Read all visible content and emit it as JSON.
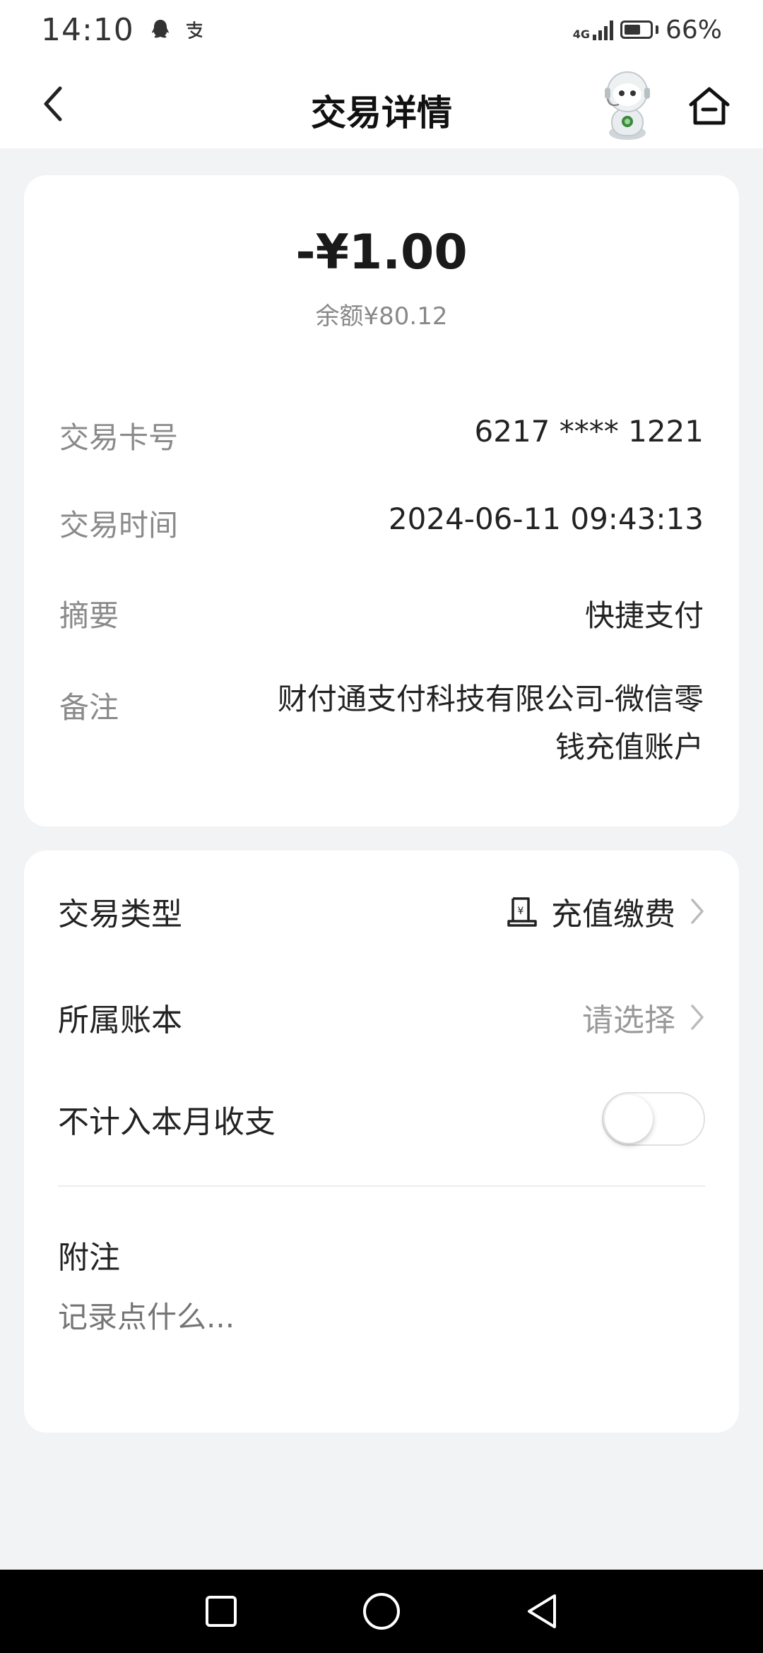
{
  "status_bar": {
    "time": "14:10",
    "network": "4G",
    "battery_percent": "66%",
    "battery_level": 0.66,
    "notification_icons": [
      "qq-icon",
      "alipay-icon"
    ]
  },
  "header": {
    "title": "交易详情",
    "back_icon": "chevron-left-icon",
    "home_icon": "home-icon"
  },
  "transaction": {
    "amount": "-¥1.00",
    "balance": "余额¥80.12",
    "details": [
      {
        "label": "交易卡号",
        "value": "6217 **** 1221"
      },
      {
        "label": "交易时间",
        "value": "2024-06-11 09:43:13"
      },
      {
        "label": "摘要",
        "value": "快捷支付"
      },
      {
        "label": "备注",
        "value": "财付通支付科技有限公司-微信零钱充值账户"
      }
    ]
  },
  "settings": {
    "type": {
      "label": "交易类型",
      "value": "充值缴费",
      "icon": "recharge-receipt-icon"
    },
    "ledger": {
      "label": "所属账本",
      "value": "请选择"
    },
    "exclude": {
      "label": "不计入本月收支",
      "enabled": false
    },
    "note": {
      "label": "附注",
      "placeholder": "记录点什么..."
    }
  },
  "colors": {
    "background": "#f2f3f5",
    "card": "#ffffff",
    "primary_text": "#222222",
    "secondary_text": "#8a8a8a"
  }
}
